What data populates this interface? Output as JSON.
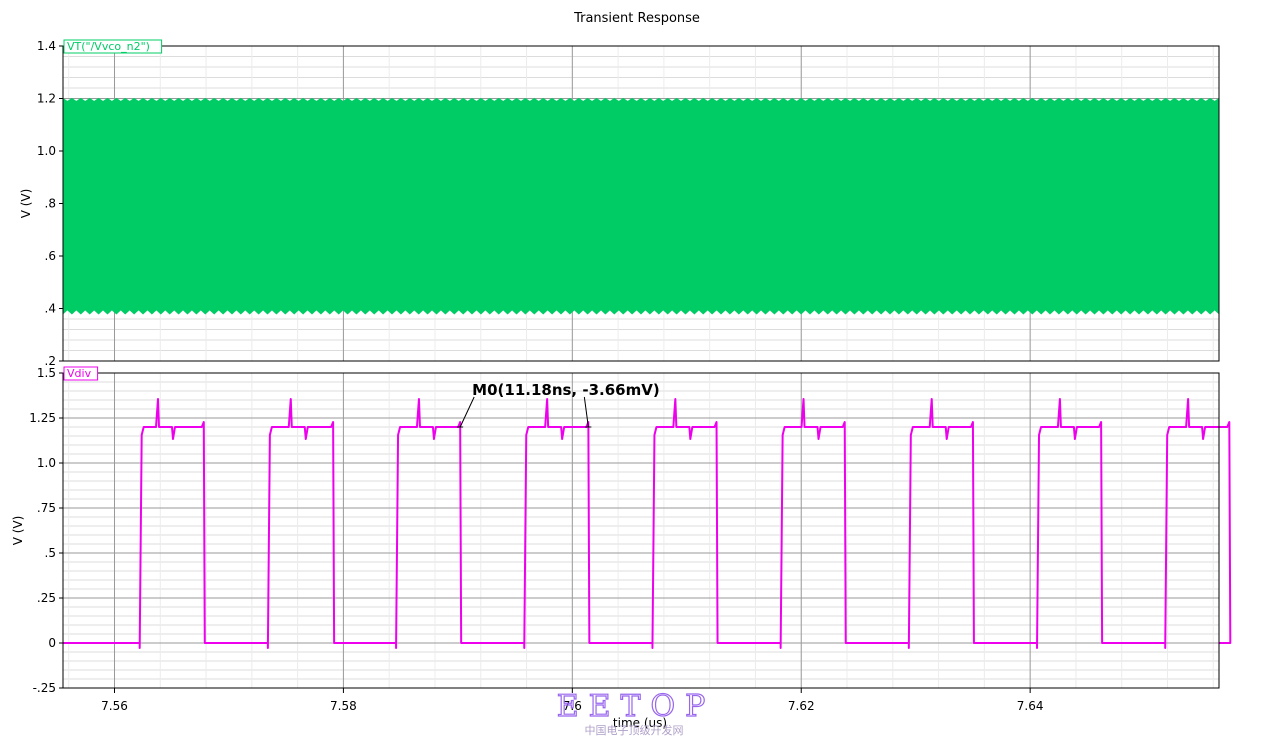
{
  "chart_data": {
    "title": "Transient Response",
    "xlabel": "time (us)",
    "x_range": [
      7.5555,
      7.6565
    ],
    "x_ticks": [
      7.56,
      7.58,
      7.6,
      7.62,
      7.64
    ],
    "x_tick_labels": [
      "7.56",
      "7.58",
      "7.6",
      "7.62",
      "7.64"
    ],
    "panels": [
      {
        "type": "area",
        "label": "VT(\"/Vvco_n2\")",
        "ylabel": "V (V)",
        "ylim": [
          0.2,
          1.4
        ],
        "y_ticks": [
          0.2,
          0.4,
          0.6,
          0.8,
          1.0,
          1.2,
          1.4
        ],
        "y_tick_labels": [
          ".2",
          ".4",
          ".6",
          ".8",
          "1.0",
          "1.2",
          "1.4"
        ],
        "color": "#00cc66",
        "envelope": {
          "min": 0.38,
          "max": 1.2
        },
        "grid": true
      },
      {
        "type": "line",
        "label": "Vdiv",
        "ylabel": "V (V)",
        "ylim": [
          -0.25,
          1.5
        ],
        "y_ticks": [
          -0.25,
          0,
          0.25,
          0.5,
          0.75,
          1.0,
          1.25,
          1.5
        ],
        "y_tick_labels": [
          "-.25",
          "0",
          ".25",
          ".5",
          ".75",
          "1.0",
          "1.25",
          "1.5"
        ],
        "color": "#ee00ee",
        "high": 1.2,
        "low": 0,
        "pulses": [
          {
            "rise": 7.5622,
            "fall": 7.5678,
            "spike": 7.5638
          },
          {
            "rise": 7.5734,
            "fall": 7.5791,
            "spike": 7.5754
          },
          {
            "rise": 7.5846,
            "fall": 7.5902,
            "spike": 7.5866
          },
          {
            "rise": 7.5958,
            "fall": 7.6014,
            "spike": 7.5978
          },
          {
            "rise": 7.607,
            "fall": 7.6126,
            "spike": 7.609
          },
          {
            "rise": 7.6182,
            "fall": 7.6238,
            "spike": 7.6202
          },
          {
            "rise": 7.6294,
            "fall": 7.635,
            "spike": 7.6314
          },
          {
            "rise": 7.6406,
            "fall": 7.6462,
            "spike": 7.6426
          },
          {
            "rise": 7.6518,
            "fall": 7.6574,
            "spike": 7.6538
          }
        ],
        "marker": {
          "text": "M0(11.18ns, -3.66mV)",
          "x1": 7.5902,
          "x2": 7.6014,
          "y": 1.2
        },
        "grid": true
      }
    ]
  },
  "watermark": {
    "text": "EETOP",
    "subtext": "中国电子顶级开发网",
    "color": "#9966ee"
  }
}
